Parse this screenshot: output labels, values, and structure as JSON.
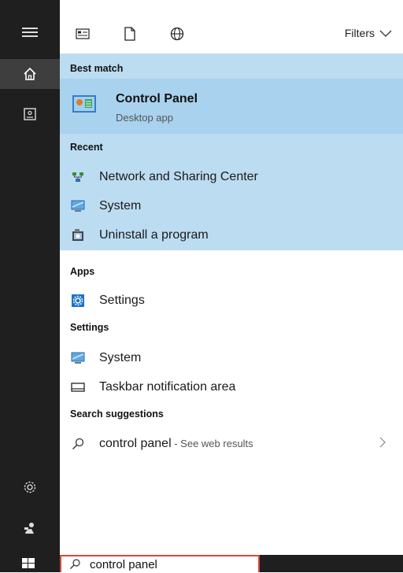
{
  "topbar": {
    "filters_label": "Filters"
  },
  "best_match": {
    "header": "Best match",
    "title": "Control Panel",
    "subtitle": "Desktop app"
  },
  "recent": {
    "header": "Recent",
    "items": [
      {
        "label": "Network and Sharing Center",
        "icon": "network-icon"
      },
      {
        "label": "System",
        "icon": "monitor-icon"
      },
      {
        "label": "Uninstall a program",
        "icon": "program-icon"
      }
    ]
  },
  "apps": {
    "header": "Apps",
    "items": [
      {
        "label": "Settings",
        "icon": "gear-icon"
      }
    ]
  },
  "settings": {
    "header": "Settings",
    "items": [
      {
        "label": "System",
        "icon": "monitor-icon"
      },
      {
        "label": "Taskbar notification area",
        "icon": "taskbar-icon"
      }
    ]
  },
  "suggestions": {
    "header": "Search suggestions",
    "items": [
      {
        "label": "control panel",
        "suffix": " - See web results"
      }
    ]
  },
  "search": {
    "query": "control panel"
  },
  "colors": {
    "highlight": "#bcdcf1",
    "best_match": "#a9d2ee",
    "rail": "#1f1f1f",
    "search_border": "#d9483b"
  }
}
